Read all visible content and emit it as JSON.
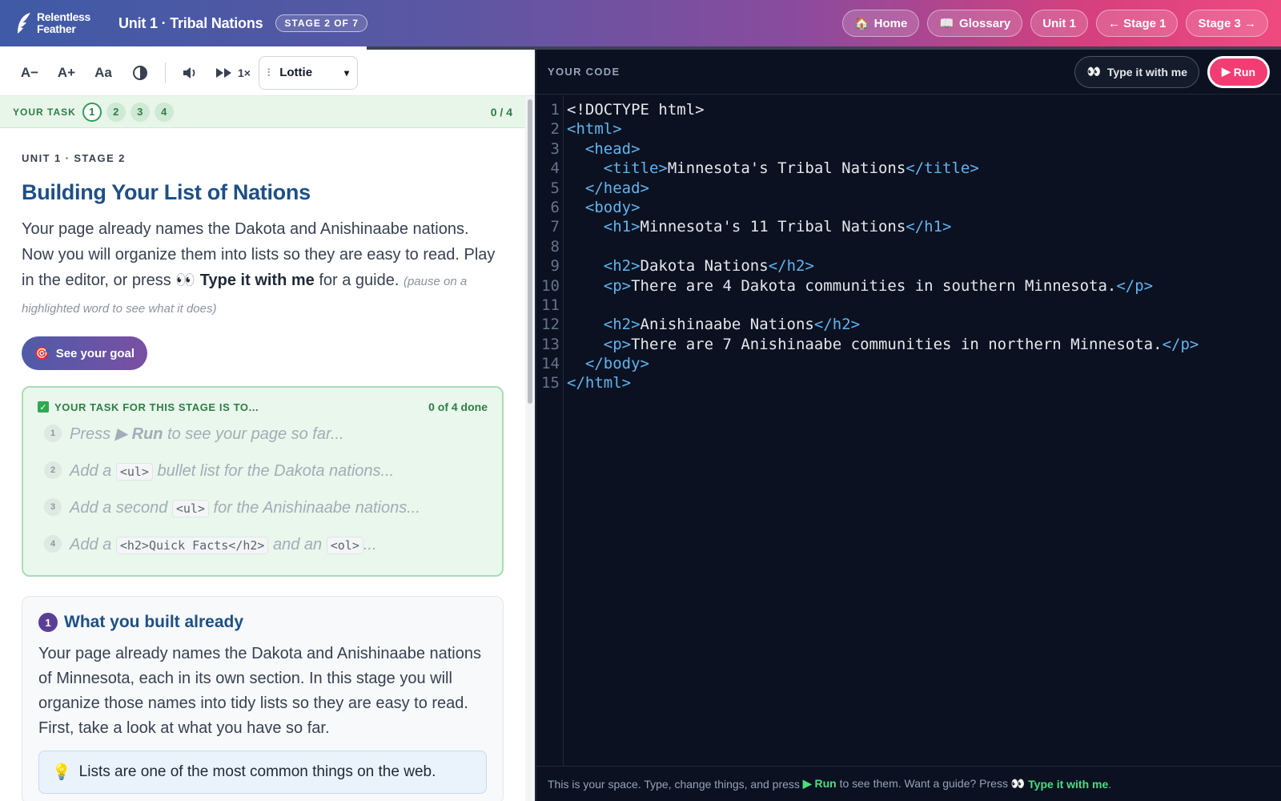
{
  "header": {
    "brand": "Relentless Feather",
    "unit_title": "Unit 1 · Tribal Nations",
    "stage_badge": "STAGE 2 OF 7",
    "nav": [
      {
        "label": "Home",
        "icon": "home-icon"
      },
      {
        "label": "Glossary",
        "icon": "book-icon"
      },
      {
        "label": "Unit 1"
      },
      {
        "label": "← Stage 1"
      },
      {
        "label": "Stage 3 →"
      }
    ]
  },
  "toolbar": {
    "decrease_font": "A−",
    "increase_font": "A+",
    "font_toggle": "Aa",
    "speed": "1×",
    "voice": "Lottie"
  },
  "task_strip": {
    "label": "YOUR TASK",
    "steps": [
      "1",
      "2",
      "3",
      "4"
    ],
    "progress": "0 / 4"
  },
  "lesson": {
    "crumb": "UNIT 1 · STAGE 2",
    "title": "Building Your List of Nations",
    "intro_part1": "Your page already names the Dakota and Anishinaabe nations. Now you will organize them into lists so they are easy to read. Play in the editor, or press 👀 ",
    "intro_bold": "Type it with me",
    "intro_part2": " for a guide. ",
    "intro_hint": "(pause on a highlighted word to see what it does)",
    "goal_button": "See your goal"
  },
  "taskbox": {
    "title": "YOUR TASK FOR THIS STAGE IS TO...",
    "done": "0 of 4 done",
    "items": [
      {
        "n": "1",
        "a": "Press ▶ ",
        "b": "Run",
        "c": " to see your page so far..."
      },
      {
        "n": "2",
        "a": "Add a ",
        "code": "<ul>",
        "c": " bullet list for the Dakota nations..."
      },
      {
        "n": "3",
        "a": "Add a second ",
        "code": "<ul>",
        "c": " for the Anishinaabe nations..."
      },
      {
        "n": "4",
        "a": "Add a ",
        "code": "<h2>Quick Facts</h2>",
        "mid": " and an ",
        "code2": "<ol>",
        "c": "..."
      }
    ]
  },
  "card": {
    "num": "1",
    "title": "What you built already",
    "body": "Your page already names the Dakota and Anishinaabe nations of Minnesota, each in its own section. In this stage you will organize those names into tidy lists so they are easy to read. First, take a look at what you have so far.",
    "tip": "Lists are one of the most common things on the web."
  },
  "editor": {
    "label": "YOUR CODE",
    "type_button": "Type it with me",
    "run_button": "Run",
    "line_numbers": [
      "1",
      "2",
      "3",
      "4",
      "5",
      "6",
      "7",
      "8",
      "9",
      "10",
      "11",
      "12",
      "13",
      "14",
      "15"
    ],
    "lines": [
      "<!DOCTYPE html>",
      "<html>",
      "  <head>",
      "    <title>Minnesota's Tribal Nations</title>",
      "  </head>",
      "  <body>",
      "    <h1>Minnesota's 11 Tribal Nations</h1>",
      "",
      "    <h2>Dakota Nations</h2>",
      "    <p>There are 4 Dakota communities in southern Minnesota.</p>",
      "",
      "    <h2>Anishinaabe Nations</h2>",
      "    <p>There are 7 Anishinaabe communities in northern Minnesota.</p>",
      "  </body>",
      "</html>"
    ],
    "footer_a": "This is your space. Type, change things, and press ",
    "footer_run": "▶ Run",
    "footer_b": " to see them. Want a guide? Press 👀 ",
    "footer_type": "Type it with me",
    "footer_c": "."
  },
  "colors": {
    "accent_run": "#f23d74",
    "tag": "#60b4f0",
    "success": "#2f7d46"
  }
}
